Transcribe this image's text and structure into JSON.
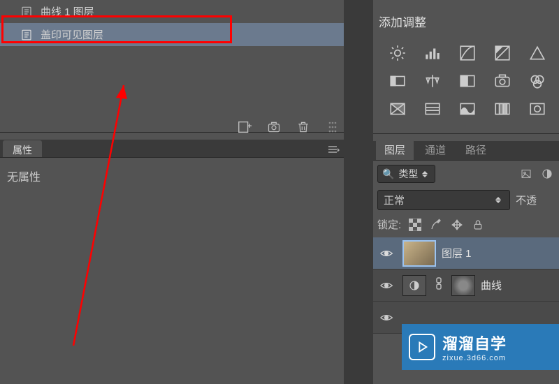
{
  "history": {
    "items": [
      {
        "label": "曲线 1 图层"
      },
      {
        "label": "盖印可见图层"
      }
    ]
  },
  "properties": {
    "tab": "属性",
    "body": "无属性"
  },
  "adjustments": {
    "header": "添加调整"
  },
  "layers": {
    "tabs": {
      "layers": "图层",
      "channels": "通道",
      "paths": "路径"
    },
    "kind_label": "类型",
    "blend_mode": "正常",
    "opacity_label": "不透",
    "lock_label": "锁定:",
    "items": [
      {
        "name": "图层 1"
      },
      {
        "name": "曲线"
      }
    ]
  },
  "watermark": {
    "title": "溜溜自学",
    "sub": "zixue.3d66.com"
  },
  "icons": {
    "search": "🔍"
  }
}
